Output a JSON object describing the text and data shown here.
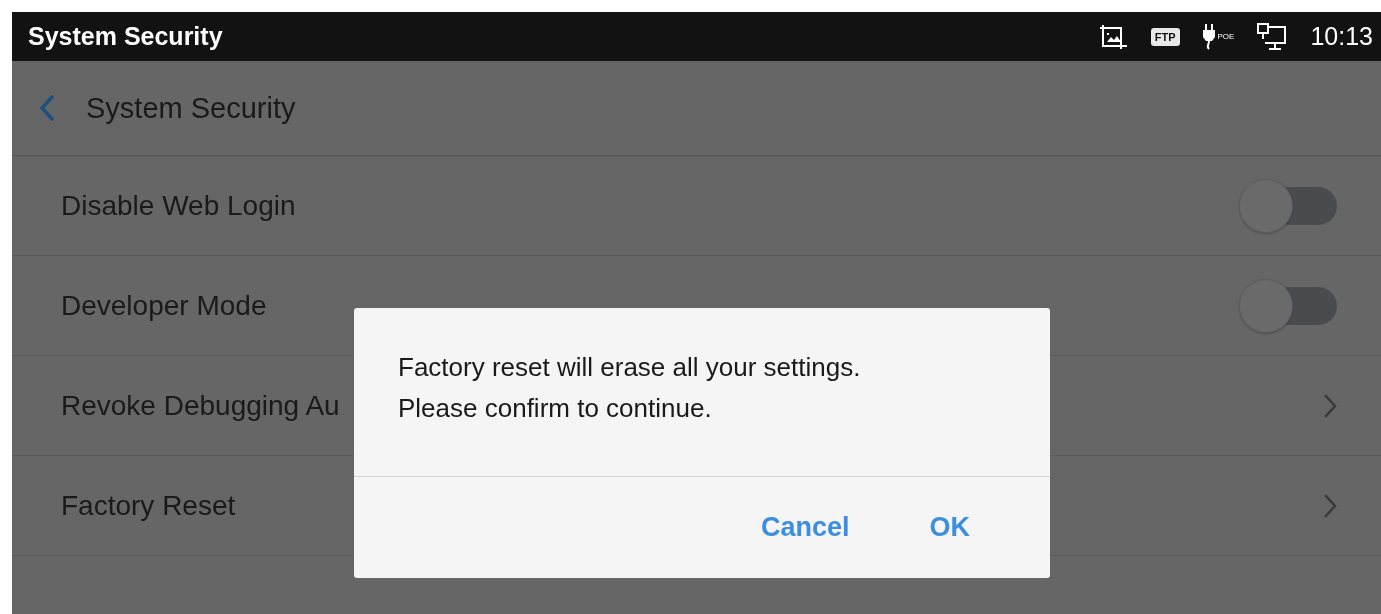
{
  "status_bar": {
    "title": "System Security",
    "time": "10:13",
    "badge": "FTP",
    "power_label": "POE"
  },
  "header": {
    "title": "System Security"
  },
  "settings": [
    {
      "label": "Disable Web Login",
      "kind": "toggle",
      "on": false
    },
    {
      "label": "Developer Mode",
      "kind": "toggle",
      "on": false
    },
    {
      "label": "Revoke Debugging Au",
      "kind": "link"
    },
    {
      "label": "Factory Reset",
      "kind": "link"
    }
  ],
  "dialog": {
    "lines": [
      "Factory reset will erase all your settings.",
      "Please confirm to continue."
    ],
    "buttons": [
      "Cancel",
      "OK"
    ]
  }
}
